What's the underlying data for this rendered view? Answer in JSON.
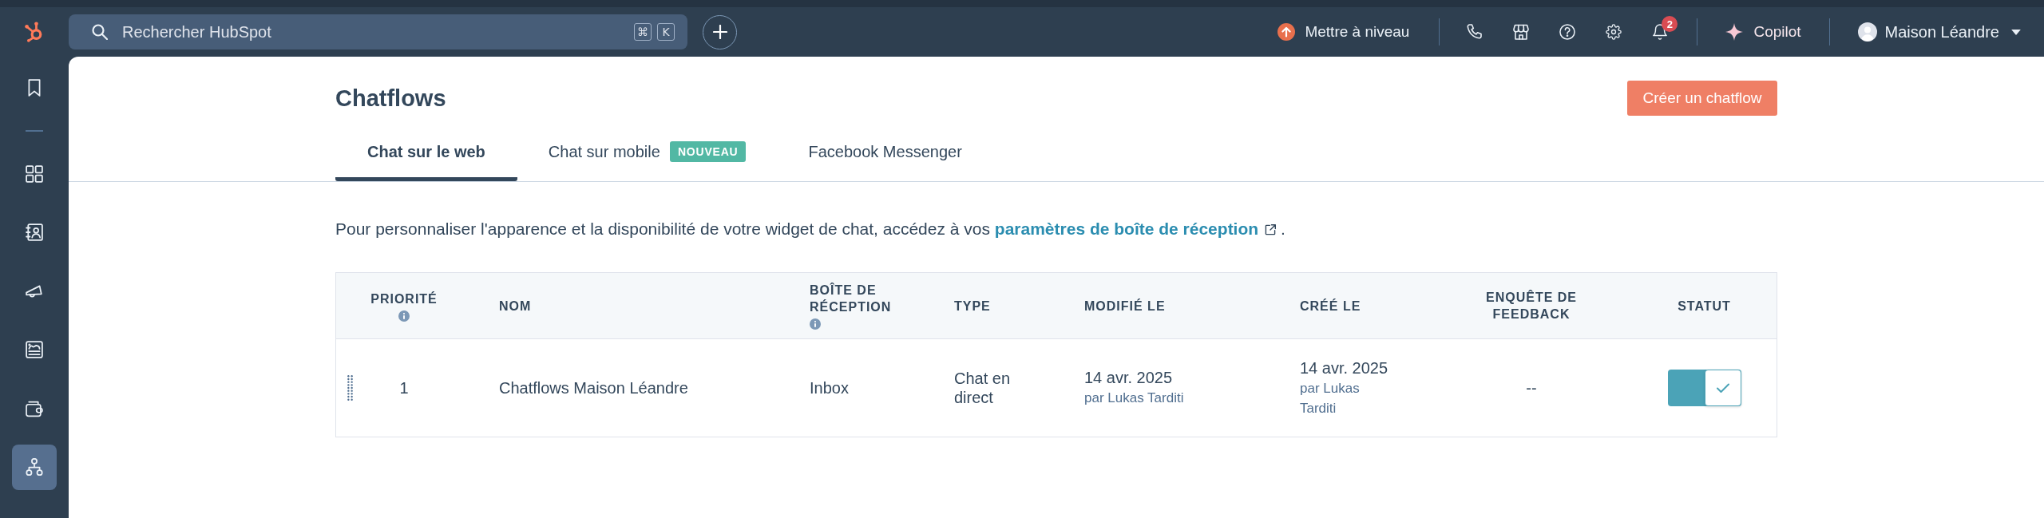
{
  "top_bar": {
    "search": {
      "placeholder": "Rechercher HubSpot",
      "shortcut_keys": [
        "⌘",
        "K"
      ]
    },
    "upgrade": "Mettre à niveau",
    "notification_count": "2",
    "copilot": "Copilot",
    "account": "Maison Léandre"
  },
  "sidebar": {
    "pinned": [
      {
        "kind": "bookmark",
        "selected": false
      }
    ],
    "items": [
      {
        "kind": "grid",
        "selected": false
      },
      {
        "kind": "contacts",
        "selected": false
      },
      {
        "kind": "megaphone",
        "selected": false
      },
      {
        "kind": "report",
        "selected": false
      },
      {
        "kind": "wallet",
        "selected": false
      },
      {
        "kind": "org-chart",
        "selected": true
      }
    ]
  },
  "page": {
    "title": "Chatflows",
    "create_button": "Créer un chatflow",
    "tabs": [
      {
        "label": "Chat sur le web",
        "selected": true
      },
      {
        "label": "Chat sur mobile",
        "selected": false,
        "badge": "NOUVEAU"
      },
      {
        "label": "Facebook Messenger",
        "selected": false
      }
    ],
    "intro": {
      "text": "Pour personnaliser l'apparence et la disponibilité de votre widget de chat, accédez à vos",
      "link": "paramètres de boîte de réception",
      "end": "."
    }
  },
  "table": {
    "columns": [
      {
        "label": "PRIORITÉ",
        "info": true
      },
      {
        "label": "NOM",
        "info": false
      },
      {
        "label": "BOÎTE DE RÉCEPTION",
        "info": true
      },
      {
        "label": "TYPE",
        "info": false
      },
      {
        "label": "MODIFIÉ LE",
        "info": false
      },
      {
        "label": "CRÉÉ LE",
        "info": false
      },
      {
        "label": "ENQUÊTE DE FEEDBACK",
        "info": false
      },
      {
        "label": "STATUT",
        "info": false
      }
    ],
    "rows": [
      {
        "priority": "1",
        "name": "Chatflows Maison Léandre",
        "inbox": "Inbox",
        "type": "Chat en direct",
        "modified": {
          "date": "14 avr. 2025",
          "by": "par Lukas Tarditi"
        },
        "created": {
          "date": "14 avr. 2025",
          "by": "par Lukas Tarditi"
        },
        "feedback": "--",
        "enabled": true
      }
    ]
  }
}
